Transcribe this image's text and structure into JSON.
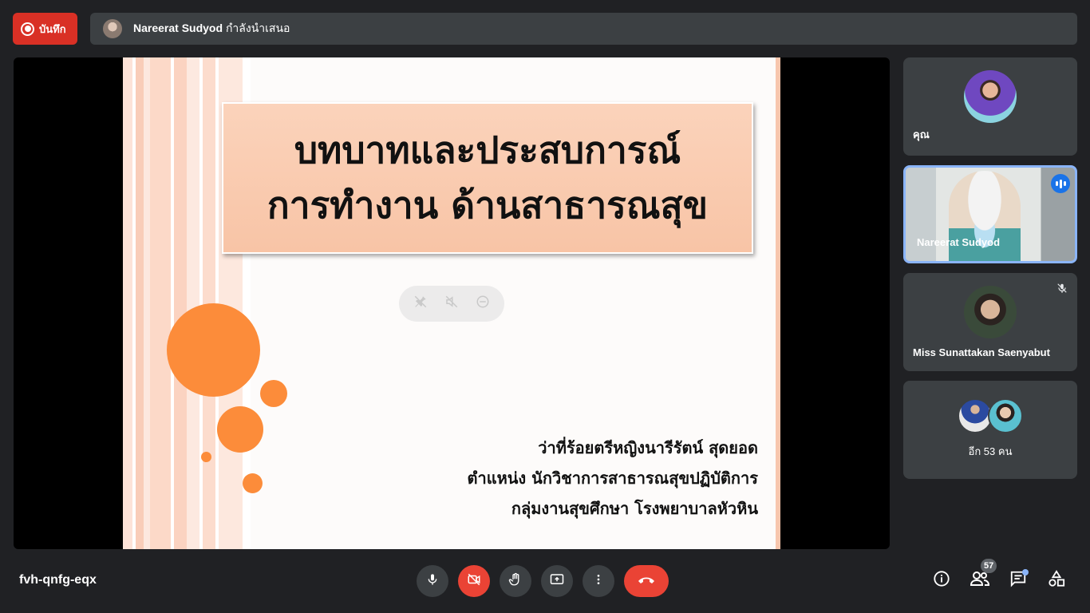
{
  "top_bar": {
    "record_label": "บันทึก",
    "presenter_name": "Nareerat Sudyod",
    "presenting_text": "กำลังนำเสนอ"
  },
  "slide": {
    "title_lines": [
      "บทบาทและประสบการณ์",
      "การทำงาน ด้านสาธารณสุข"
    ],
    "presenter_lines": [
      "ว่าที่ร้อยตรีหญิงนารีรัตน์ สุดยอด",
      "ตำแหน่ง นักวิชาการสาธารณสุขปฏิบัติการ",
      "กลุ่มงานสุขศึกษา โรงพยาบาลหัวหิน"
    ]
  },
  "participants": [
    {
      "label": "คุณ"
    },
    {
      "label": "Nareerat Sudyod",
      "speaking": true
    },
    {
      "label": "Miss Sunattakan Saenyabut",
      "muted": true
    },
    {
      "label": "อีก 53 คน"
    }
  ],
  "bottom_bar": {
    "meeting_code": "fvh-qnfg-eqx",
    "participant_count": "57"
  },
  "colors": {
    "background": "#202124",
    "tile": "#3c4043",
    "record": "#d93025",
    "hangup": "#ea4335",
    "speaking_accent": "#1a73e8",
    "slide_circle": "#fc8c3a",
    "title_box": "#f8c4a6"
  },
  "icons": [
    "record-icon",
    "mic-icon",
    "camera-off-icon",
    "raise-hand-icon",
    "present-screen-icon",
    "more-options-icon",
    "hangup-icon",
    "info-icon",
    "people-icon",
    "chat-icon",
    "activities-icon",
    "mic-off-icon",
    "pin-icon",
    "mute-icon",
    "remove-icon",
    "speaking-icon"
  ]
}
